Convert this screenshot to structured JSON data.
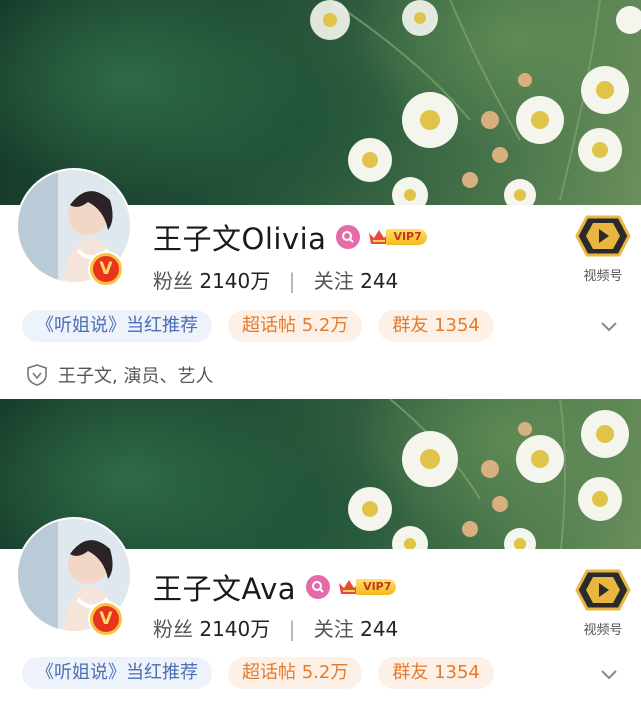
{
  "profiles": [
    {
      "name": "王子文Olivia",
      "verify_badge": "V",
      "vip_label": "VIP7",
      "stats": {
        "fans_label": "粉丝",
        "fans_value": "2140万",
        "follow_label": "关注",
        "follow_value": "244"
      },
      "video_label": "视频号",
      "tags": [
        "《听姐说》当红推荐",
        "超话帖 5.2万",
        "群友 1354"
      ],
      "identity": "王子文, 演员、艺人"
    },
    {
      "name": "王子文Ava",
      "verify_badge": "V",
      "vip_label": "VIP7",
      "stats": {
        "fans_label": "粉丝",
        "fans_value": "2140万",
        "follow_label": "关注",
        "follow_value": "244"
      },
      "video_label": "视频号",
      "tags": [
        "《听姐说》当红推荐",
        "超话帖 5.2万",
        "群友 1354"
      ]
    }
  ],
  "icons": {
    "search_badge": "search-icon",
    "vip": "crown-icon",
    "video": "play-icon",
    "expand": "chevron-down-icon",
    "identity": "shield-check-icon"
  },
  "colors": {
    "tag_blue_text": "#4a6fb5",
    "tag_orange_text": "#e47a2c",
    "vip_gold": "#f5b71e",
    "verify_red": "#e8341f",
    "search_pink": "#e46aa8"
  }
}
